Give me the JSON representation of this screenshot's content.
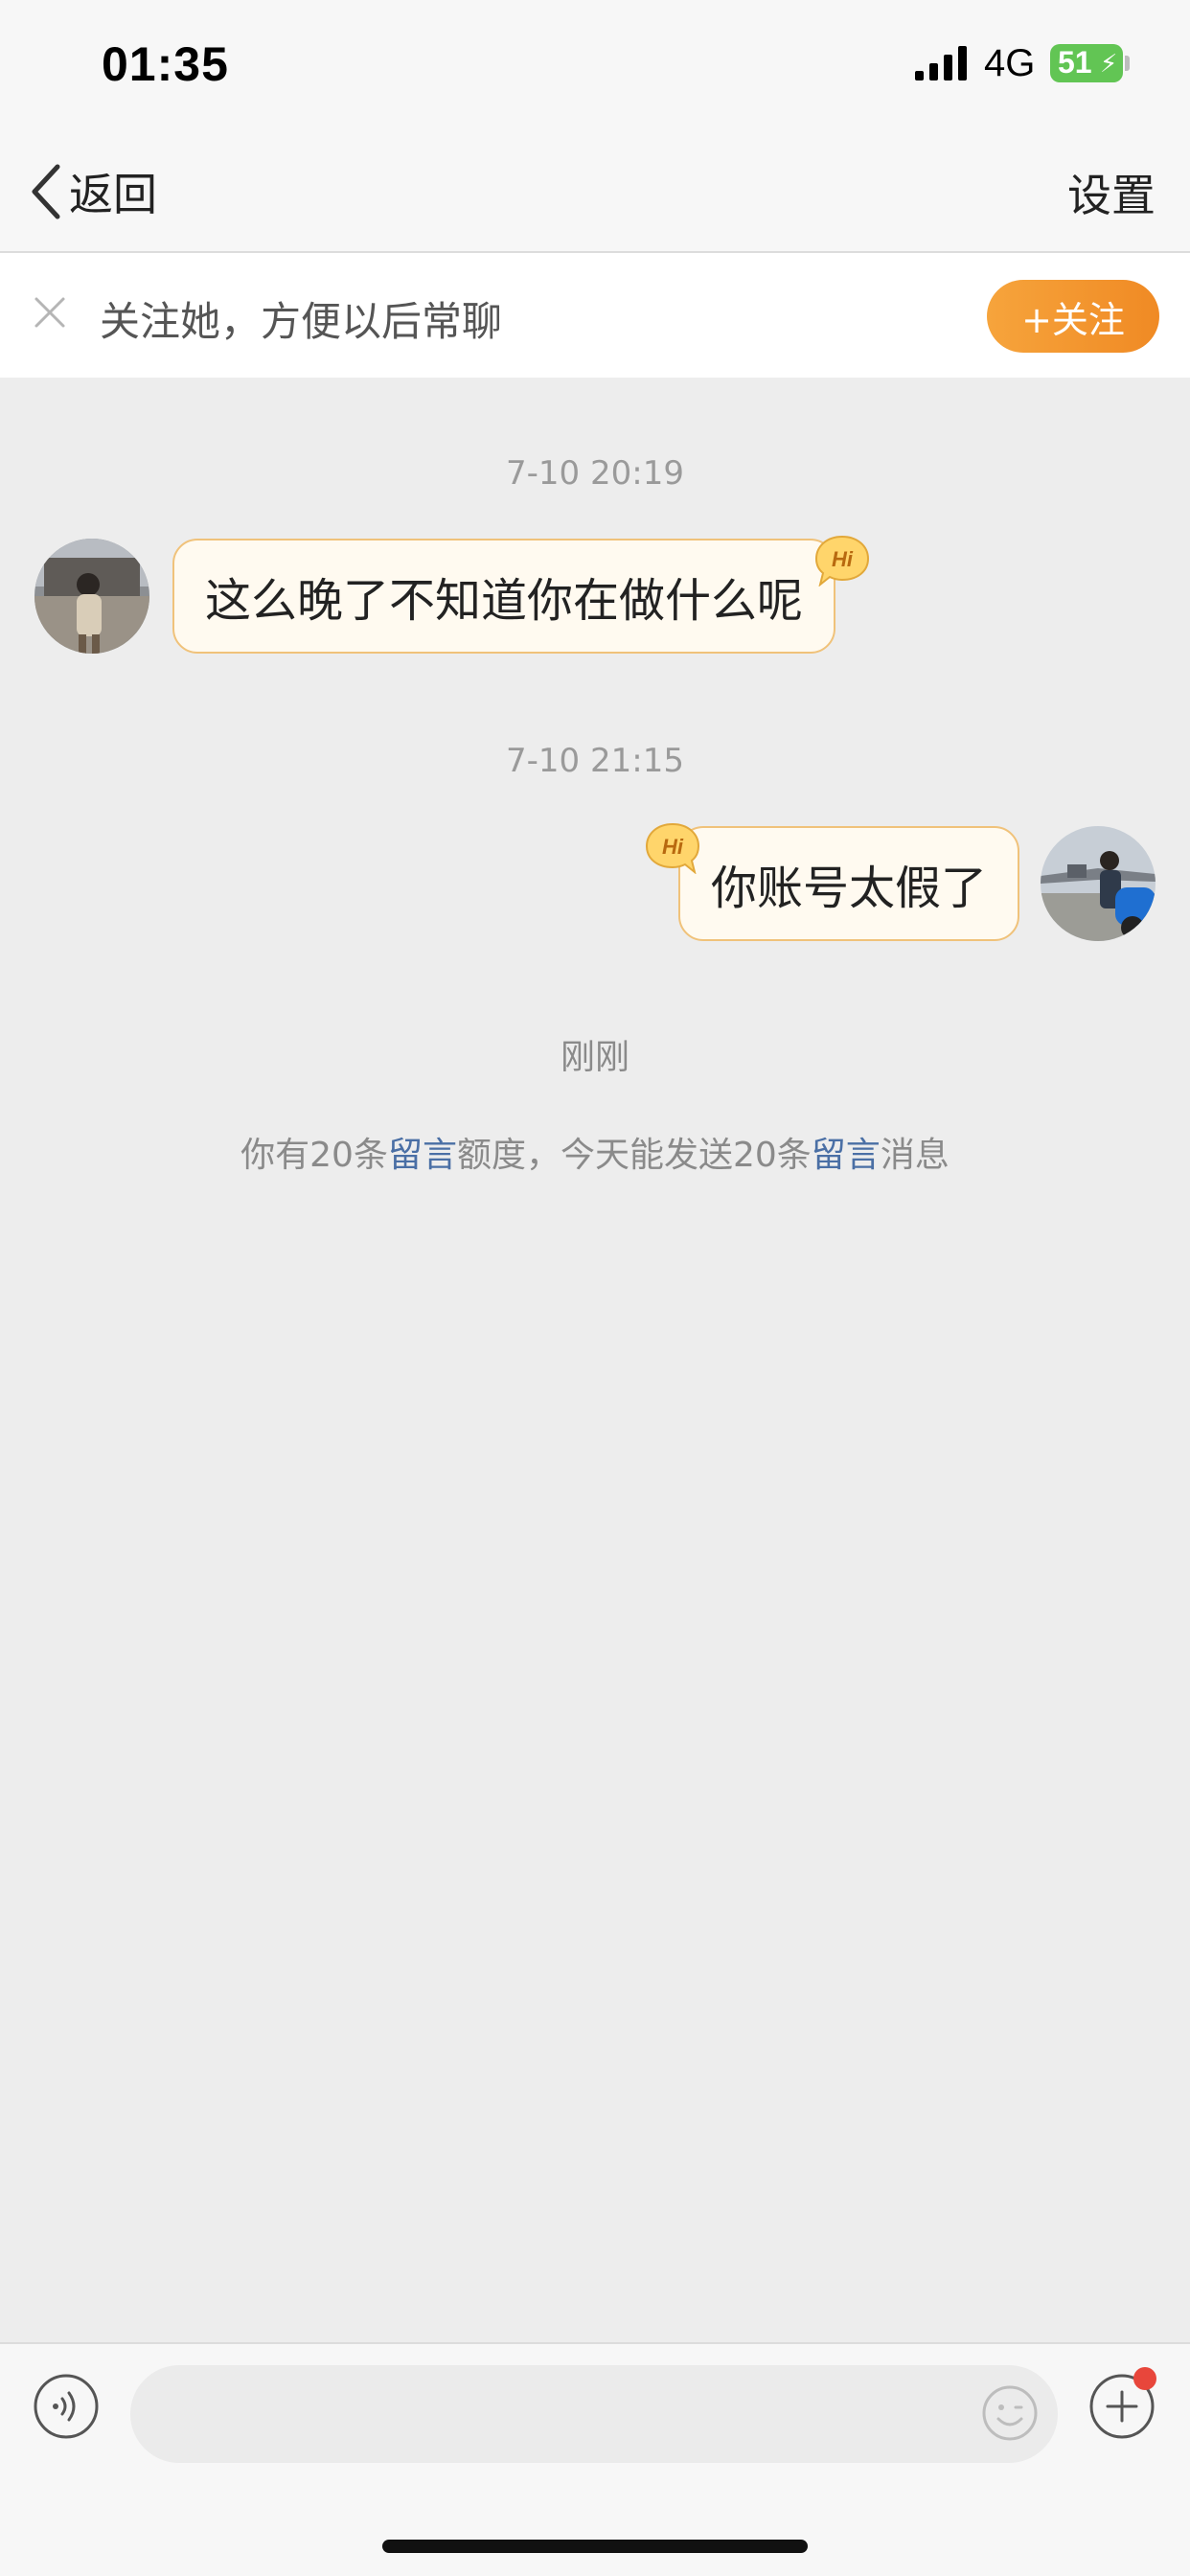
{
  "status_bar": {
    "time": "01:35",
    "network": "4G",
    "battery_percent": "51"
  },
  "nav": {
    "back_label": "返回",
    "settings_label": "设置"
  },
  "follow_banner": {
    "hint": "关注她，方便以后常聊",
    "button_label": "+关注"
  },
  "messages": [
    {
      "timestamp": "7-10 20:19",
      "sender": "other",
      "text": "这么晚了不知道你在做什么呢",
      "badge": "Hi"
    },
    {
      "timestamp": "7-10 21:15",
      "sender": "me",
      "text": "你账号太假了",
      "badge": "Hi"
    }
  ],
  "system": {
    "time_label": "刚刚",
    "quota_prefix": "你有20条",
    "quota_link1": "留言",
    "quota_middle": "额度，今天能发送20条",
    "quota_link2": "留言",
    "quota_suffix": "消息"
  },
  "input": {
    "placeholder": ""
  },
  "colors": {
    "accent_orange": "#f08a24",
    "bubble_border": "#f0c27a",
    "link_blue": "#4a6fa5",
    "battery_green": "#62c554",
    "notify_red": "#e8463b"
  }
}
